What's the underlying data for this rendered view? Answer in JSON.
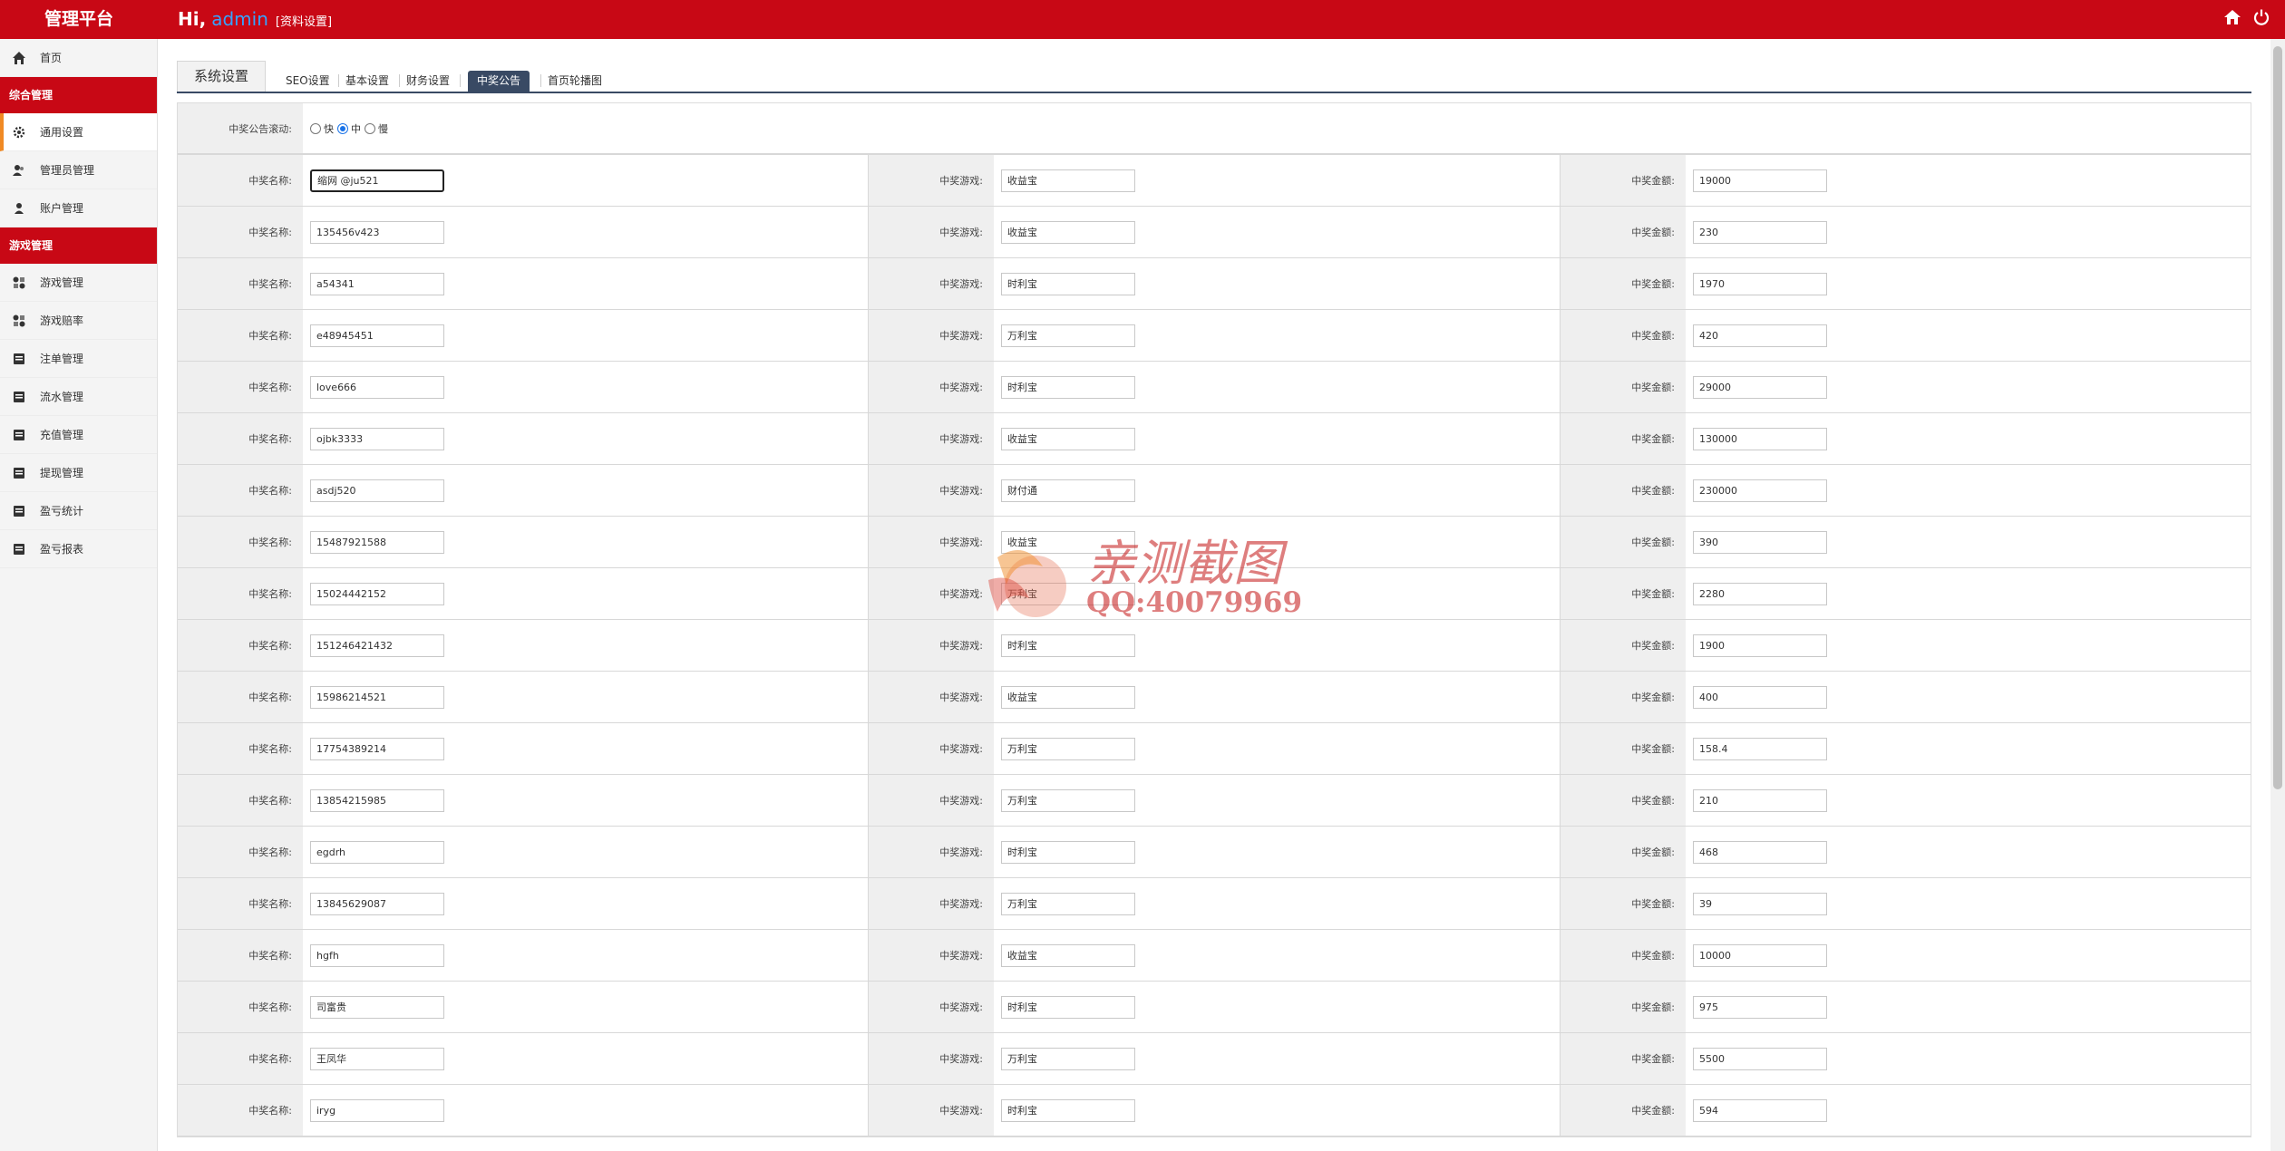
{
  "header": {
    "brand": "管理平台",
    "greeting": "Hi,",
    "username": "admin",
    "profile_link": "[资料设置]"
  },
  "sidebar": {
    "home": "首页",
    "section1": "综合管理",
    "items1": [
      "通用设置",
      "管理员管理",
      "账户管理"
    ],
    "section2": "游戏管理",
    "items2": [
      "游戏管理",
      "游戏赔率",
      "注单管理",
      "流水管理",
      "充值管理",
      "提现管理",
      "盈亏统计",
      "盈亏报表"
    ]
  },
  "tabs": {
    "main": "系统设置",
    "items": [
      "SEO设置",
      "基本设置",
      "财务设置",
      "中奖公告",
      "首页轮播图"
    ],
    "selected": "中奖公告"
  },
  "scroll_setting": {
    "label": "中奖公告滚动:",
    "options": [
      "快",
      "中",
      "慢"
    ],
    "selected": "中"
  },
  "labels": {
    "name": "中奖名称:",
    "game": "中奖游戏:",
    "amount": "中奖金额:"
  },
  "rows": [
    {
      "name": "缩网 @ju521",
      "game": "收益宝",
      "amount": "19000"
    },
    {
      "name": "135456v423",
      "game": "收益宝",
      "amount": "230"
    },
    {
      "name": "a54341",
      "game": "时利宝",
      "amount": "1970"
    },
    {
      "name": "e48945451",
      "game": "万利宝",
      "amount": "420"
    },
    {
      "name": "love666",
      "game": "时利宝",
      "amount": "29000"
    },
    {
      "name": "ojbk3333",
      "game": "收益宝",
      "amount": "130000"
    },
    {
      "name": "asdj520",
      "game": "财付通",
      "amount": "230000"
    },
    {
      "name": "15487921588",
      "game": "收益宝",
      "amount": "390"
    },
    {
      "name": "15024442152",
      "game": "万利宝",
      "amount": "2280"
    },
    {
      "name": "151246421432",
      "game": "时利宝",
      "amount": "1900"
    },
    {
      "name": "15986214521",
      "game": "收益宝",
      "amount": "400"
    },
    {
      "name": "17754389214",
      "game": "万利宝",
      "amount": "158.4"
    },
    {
      "name": "13854215985",
      "game": "万利宝",
      "amount": "210"
    },
    {
      "name": "egdrh",
      "game": "时利宝",
      "amount": "468"
    },
    {
      "name": "13845629087",
      "game": "万利宝",
      "amount": "39"
    },
    {
      "name": "hgfh",
      "game": "收益宝",
      "amount": "10000"
    },
    {
      "name": "司富贵",
      "game": "时利宝",
      "amount": "975"
    },
    {
      "name": "王凤华",
      "game": "万利宝",
      "amount": "5500"
    },
    {
      "name": "iryg",
      "game": "时利宝",
      "amount": "594"
    }
  ],
  "watermark": {
    "text": "亲测截图",
    "qq": "QQ:40079969"
  }
}
